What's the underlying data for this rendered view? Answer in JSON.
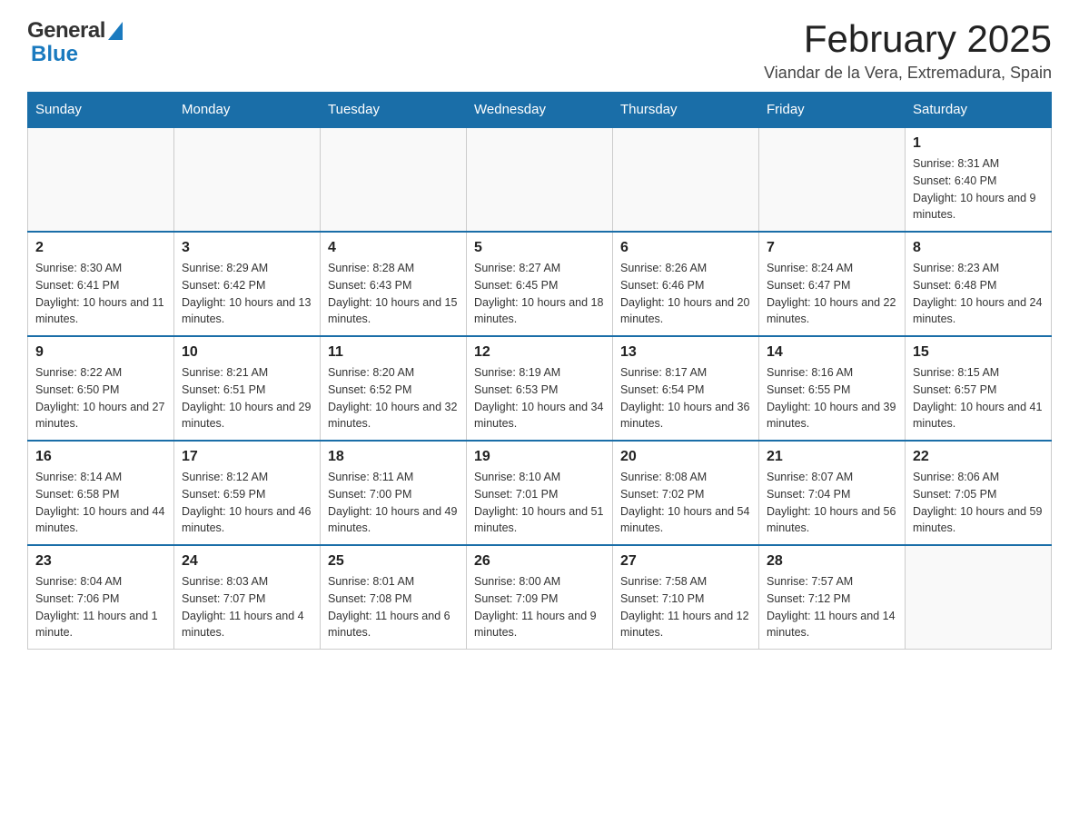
{
  "header": {
    "logo": {
      "general": "General",
      "blue": "Blue"
    },
    "month_title": "February 2025",
    "location": "Viandar de la Vera, Extremadura, Spain"
  },
  "weekdays": [
    "Sunday",
    "Monday",
    "Tuesday",
    "Wednesday",
    "Thursday",
    "Friday",
    "Saturday"
  ],
  "weeks": [
    [
      {
        "day": "",
        "sunrise": "",
        "sunset": "",
        "daylight": ""
      },
      {
        "day": "",
        "sunrise": "",
        "sunset": "",
        "daylight": ""
      },
      {
        "day": "",
        "sunrise": "",
        "sunset": "",
        "daylight": ""
      },
      {
        "day": "",
        "sunrise": "",
        "sunset": "",
        "daylight": ""
      },
      {
        "day": "",
        "sunrise": "",
        "sunset": "",
        "daylight": ""
      },
      {
        "day": "",
        "sunrise": "",
        "sunset": "",
        "daylight": ""
      },
      {
        "day": "1",
        "sunrise": "Sunrise: 8:31 AM",
        "sunset": "Sunset: 6:40 PM",
        "daylight": "Daylight: 10 hours and 9 minutes."
      }
    ],
    [
      {
        "day": "2",
        "sunrise": "Sunrise: 8:30 AM",
        "sunset": "Sunset: 6:41 PM",
        "daylight": "Daylight: 10 hours and 11 minutes."
      },
      {
        "day": "3",
        "sunrise": "Sunrise: 8:29 AM",
        "sunset": "Sunset: 6:42 PM",
        "daylight": "Daylight: 10 hours and 13 minutes."
      },
      {
        "day": "4",
        "sunrise": "Sunrise: 8:28 AM",
        "sunset": "Sunset: 6:43 PM",
        "daylight": "Daylight: 10 hours and 15 minutes."
      },
      {
        "day": "5",
        "sunrise": "Sunrise: 8:27 AM",
        "sunset": "Sunset: 6:45 PM",
        "daylight": "Daylight: 10 hours and 18 minutes."
      },
      {
        "day": "6",
        "sunrise": "Sunrise: 8:26 AM",
        "sunset": "Sunset: 6:46 PM",
        "daylight": "Daylight: 10 hours and 20 minutes."
      },
      {
        "day": "7",
        "sunrise": "Sunrise: 8:24 AM",
        "sunset": "Sunset: 6:47 PM",
        "daylight": "Daylight: 10 hours and 22 minutes."
      },
      {
        "day": "8",
        "sunrise": "Sunrise: 8:23 AM",
        "sunset": "Sunset: 6:48 PM",
        "daylight": "Daylight: 10 hours and 24 minutes."
      }
    ],
    [
      {
        "day": "9",
        "sunrise": "Sunrise: 8:22 AM",
        "sunset": "Sunset: 6:50 PM",
        "daylight": "Daylight: 10 hours and 27 minutes."
      },
      {
        "day": "10",
        "sunrise": "Sunrise: 8:21 AM",
        "sunset": "Sunset: 6:51 PM",
        "daylight": "Daylight: 10 hours and 29 minutes."
      },
      {
        "day": "11",
        "sunrise": "Sunrise: 8:20 AM",
        "sunset": "Sunset: 6:52 PM",
        "daylight": "Daylight: 10 hours and 32 minutes."
      },
      {
        "day": "12",
        "sunrise": "Sunrise: 8:19 AM",
        "sunset": "Sunset: 6:53 PM",
        "daylight": "Daylight: 10 hours and 34 minutes."
      },
      {
        "day": "13",
        "sunrise": "Sunrise: 8:17 AM",
        "sunset": "Sunset: 6:54 PM",
        "daylight": "Daylight: 10 hours and 36 minutes."
      },
      {
        "day": "14",
        "sunrise": "Sunrise: 8:16 AM",
        "sunset": "Sunset: 6:55 PM",
        "daylight": "Daylight: 10 hours and 39 minutes."
      },
      {
        "day": "15",
        "sunrise": "Sunrise: 8:15 AM",
        "sunset": "Sunset: 6:57 PM",
        "daylight": "Daylight: 10 hours and 41 minutes."
      }
    ],
    [
      {
        "day": "16",
        "sunrise": "Sunrise: 8:14 AM",
        "sunset": "Sunset: 6:58 PM",
        "daylight": "Daylight: 10 hours and 44 minutes."
      },
      {
        "day": "17",
        "sunrise": "Sunrise: 8:12 AM",
        "sunset": "Sunset: 6:59 PM",
        "daylight": "Daylight: 10 hours and 46 minutes."
      },
      {
        "day": "18",
        "sunrise": "Sunrise: 8:11 AM",
        "sunset": "Sunset: 7:00 PM",
        "daylight": "Daylight: 10 hours and 49 minutes."
      },
      {
        "day": "19",
        "sunrise": "Sunrise: 8:10 AM",
        "sunset": "Sunset: 7:01 PM",
        "daylight": "Daylight: 10 hours and 51 minutes."
      },
      {
        "day": "20",
        "sunrise": "Sunrise: 8:08 AM",
        "sunset": "Sunset: 7:02 PM",
        "daylight": "Daylight: 10 hours and 54 minutes."
      },
      {
        "day": "21",
        "sunrise": "Sunrise: 8:07 AM",
        "sunset": "Sunset: 7:04 PM",
        "daylight": "Daylight: 10 hours and 56 minutes."
      },
      {
        "day": "22",
        "sunrise": "Sunrise: 8:06 AM",
        "sunset": "Sunset: 7:05 PM",
        "daylight": "Daylight: 10 hours and 59 minutes."
      }
    ],
    [
      {
        "day": "23",
        "sunrise": "Sunrise: 8:04 AM",
        "sunset": "Sunset: 7:06 PM",
        "daylight": "Daylight: 11 hours and 1 minute."
      },
      {
        "day": "24",
        "sunrise": "Sunrise: 8:03 AM",
        "sunset": "Sunset: 7:07 PM",
        "daylight": "Daylight: 11 hours and 4 minutes."
      },
      {
        "day": "25",
        "sunrise": "Sunrise: 8:01 AM",
        "sunset": "Sunset: 7:08 PM",
        "daylight": "Daylight: 11 hours and 6 minutes."
      },
      {
        "day": "26",
        "sunrise": "Sunrise: 8:00 AM",
        "sunset": "Sunset: 7:09 PM",
        "daylight": "Daylight: 11 hours and 9 minutes."
      },
      {
        "day": "27",
        "sunrise": "Sunrise: 7:58 AM",
        "sunset": "Sunset: 7:10 PM",
        "daylight": "Daylight: 11 hours and 12 minutes."
      },
      {
        "day": "28",
        "sunrise": "Sunrise: 7:57 AM",
        "sunset": "Sunset: 7:12 PM",
        "daylight": "Daylight: 11 hours and 14 minutes."
      },
      {
        "day": "",
        "sunrise": "",
        "sunset": "",
        "daylight": ""
      }
    ]
  ]
}
